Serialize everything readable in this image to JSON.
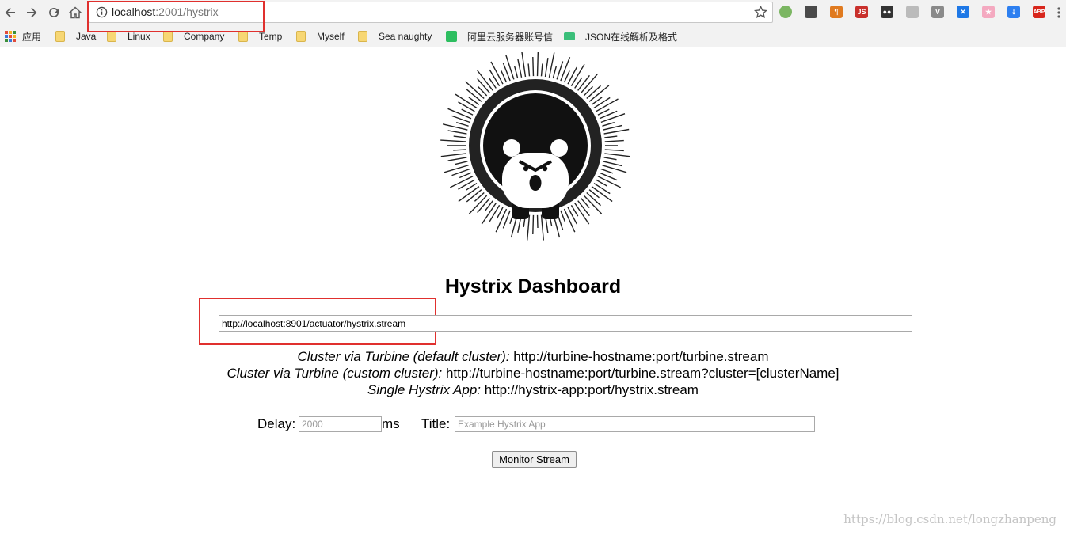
{
  "browser": {
    "url_host": "localhost",
    "url_path": ":2001/hystrix",
    "bookmarks": [
      {
        "label": "应用",
        "type": "apps"
      },
      {
        "label": "Java",
        "type": "folder"
      },
      {
        "label": "Linux",
        "type": "folder"
      },
      {
        "label": "Company",
        "type": "folder"
      },
      {
        "label": "Temp",
        "type": "folder"
      },
      {
        "label": "Myself",
        "type": "folder"
      },
      {
        "label": "Sea naughty",
        "type": "folder"
      },
      {
        "label": "阿里云服务器账号信",
        "type": "evernote"
      },
      {
        "label": "JSON在线解析及格式",
        "type": "json"
      }
    ],
    "extensions": [
      {
        "name": "green-circle-icon",
        "color": "#7bb662",
        "text": ""
      },
      {
        "name": "evernote-icon",
        "color": "#4a4a4a",
        "text": ""
      },
      {
        "name": "pilcrow-icon",
        "color": "#e07a1f",
        "text": "¶"
      },
      {
        "name": "js-icon",
        "color": "#c9302c",
        "text": "JS"
      },
      {
        "name": "tampermonkey-icon",
        "color": "#333333",
        "text": "●●"
      },
      {
        "name": "feather-icon",
        "color": "#bbbbbb",
        "text": ""
      },
      {
        "name": "vue-icon",
        "color": "#8a8a8a",
        "text": "V"
      },
      {
        "name": "proxy-icon",
        "color": "#1e78e6",
        "text": "✕"
      },
      {
        "name": "star-ext-icon",
        "color": "#f4a9c0",
        "text": "★"
      },
      {
        "name": "pocket-icon",
        "color": "#2d7ff0",
        "text": "⇣"
      },
      {
        "name": "adblock-icon",
        "color": "#d8261c",
        "text": "ABP"
      }
    ]
  },
  "page": {
    "title": "Hystrix Dashboard",
    "stream_url": "http://localhost:8901/actuator/hystrix.stream",
    "hints": [
      {
        "label": "Cluster via Turbine (default cluster):",
        "value": " http://turbine-hostname:port/turbine.stream"
      },
      {
        "label": "Cluster via Turbine (custom cluster):",
        "value": " http://turbine-hostname:port/turbine.stream?cluster=[clusterName]"
      },
      {
        "label": "Single Hystrix App:",
        "value": " http://hystrix-app:port/hystrix.stream"
      }
    ],
    "delay_label": "Delay:",
    "delay_placeholder": "2000",
    "delay_unit": "ms",
    "title_label": "Title:",
    "title_placeholder": "Example Hystrix App",
    "monitor_button": "Monitor Stream"
  },
  "watermark": "https://blog.csdn.net/longzhanpeng",
  "colors": {
    "annotation_red": "#e0302e",
    "chrome_bg": "#f2f2f2"
  }
}
